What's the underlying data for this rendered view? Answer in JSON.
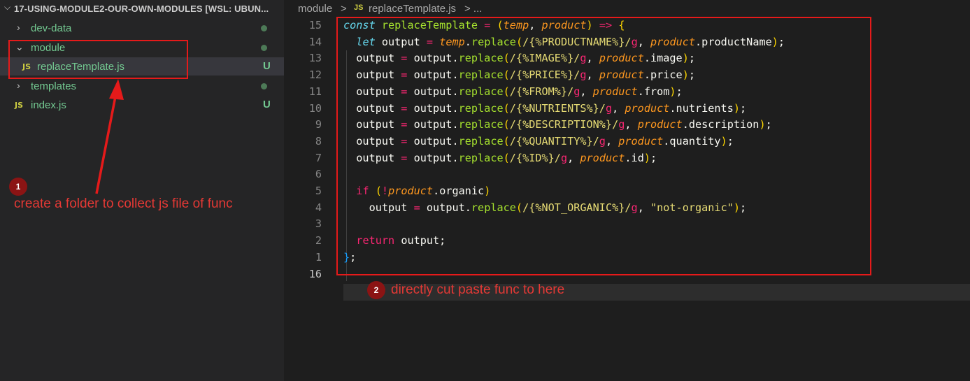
{
  "explorer": {
    "title": "17-USING-MODULE2-OUR-OWN-MODULES [WSL: UBUN...",
    "items": [
      {
        "label": "dev-data",
        "status": "dot"
      },
      {
        "label": "module",
        "status": "dot"
      },
      {
        "label": "replaceTemplate.js",
        "status": "U",
        "icon": "JS"
      },
      {
        "label": "templates",
        "status": "dot"
      },
      {
        "label": "index.js",
        "status": "U",
        "icon": "JS"
      }
    ]
  },
  "breadcrumb": {
    "folder": "module",
    "sep": ">",
    "icon": "JS",
    "file": "replaceTemplate.js",
    "ellipsis": "> ..."
  },
  "editor": {
    "line_numbers": [
      "15",
      "14",
      "13",
      "12",
      "11",
      "10",
      "9",
      "8",
      "7",
      "6",
      "5",
      "4",
      "3",
      "2",
      "1",
      "16"
    ],
    "code": [
      "const replaceTemplate = (temp, product) => {",
      "  let output = temp.replace(/{%PRODUCTNAME%}/g, product.productName);",
      "  output = output.replace(/{%IMAGE%}/g, product.image);",
      "  output = output.replace(/{%PRICE%}/g, product.price);",
      "  output = output.replace(/{%FROM%}/g, product.from);",
      "  output = output.replace(/{%NUTRIENTS%}/g, product.nutrients);",
      "  output = output.replace(/{%DESCRIPTION%}/g, product.description);",
      "  output = output.replace(/{%QUANTITY%}/g, product.quantity);",
      "  output = output.replace(/{%ID%}/g, product.id);",
      "",
      "  if (!product.organic)",
      "    output = output.replace(/{%NOT_ORGANIC%}/g, \"not-organic\");",
      "",
      "  return output;",
      "};",
      ""
    ]
  },
  "annotations": {
    "note1_number": "1",
    "note1_text": "create a folder to collect js file of func",
    "note2_number": "2",
    "note2_text": "directly cut paste func to here"
  },
  "colors": {
    "annotation_red": "#e51a1a",
    "untracked_green": "#73c991"
  }
}
